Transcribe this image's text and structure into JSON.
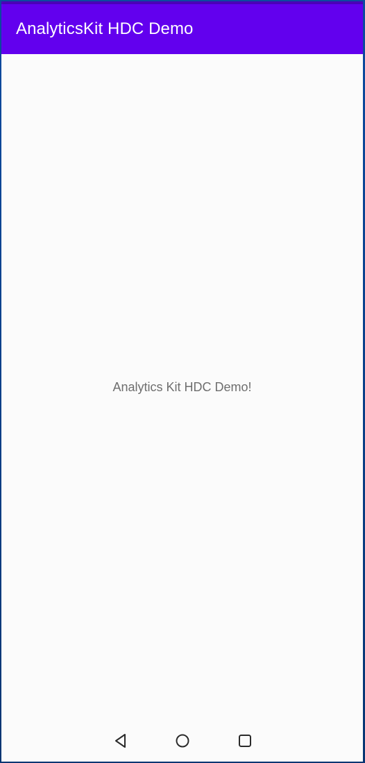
{
  "app_bar": {
    "title": "AnalyticsKit HDC Demo"
  },
  "main": {
    "message": "Analytics Kit HDC Demo!"
  },
  "nav_bar": {
    "back_icon": "back-triangle-icon",
    "home_icon": "home-circle-icon",
    "recent_icon": "recent-apps-square-icon"
  },
  "colors": {
    "app_bar": "#6200ee",
    "status_strip": "#4b01b7",
    "background": "#fbfbfb",
    "message_text": "#6e6e6e"
  }
}
